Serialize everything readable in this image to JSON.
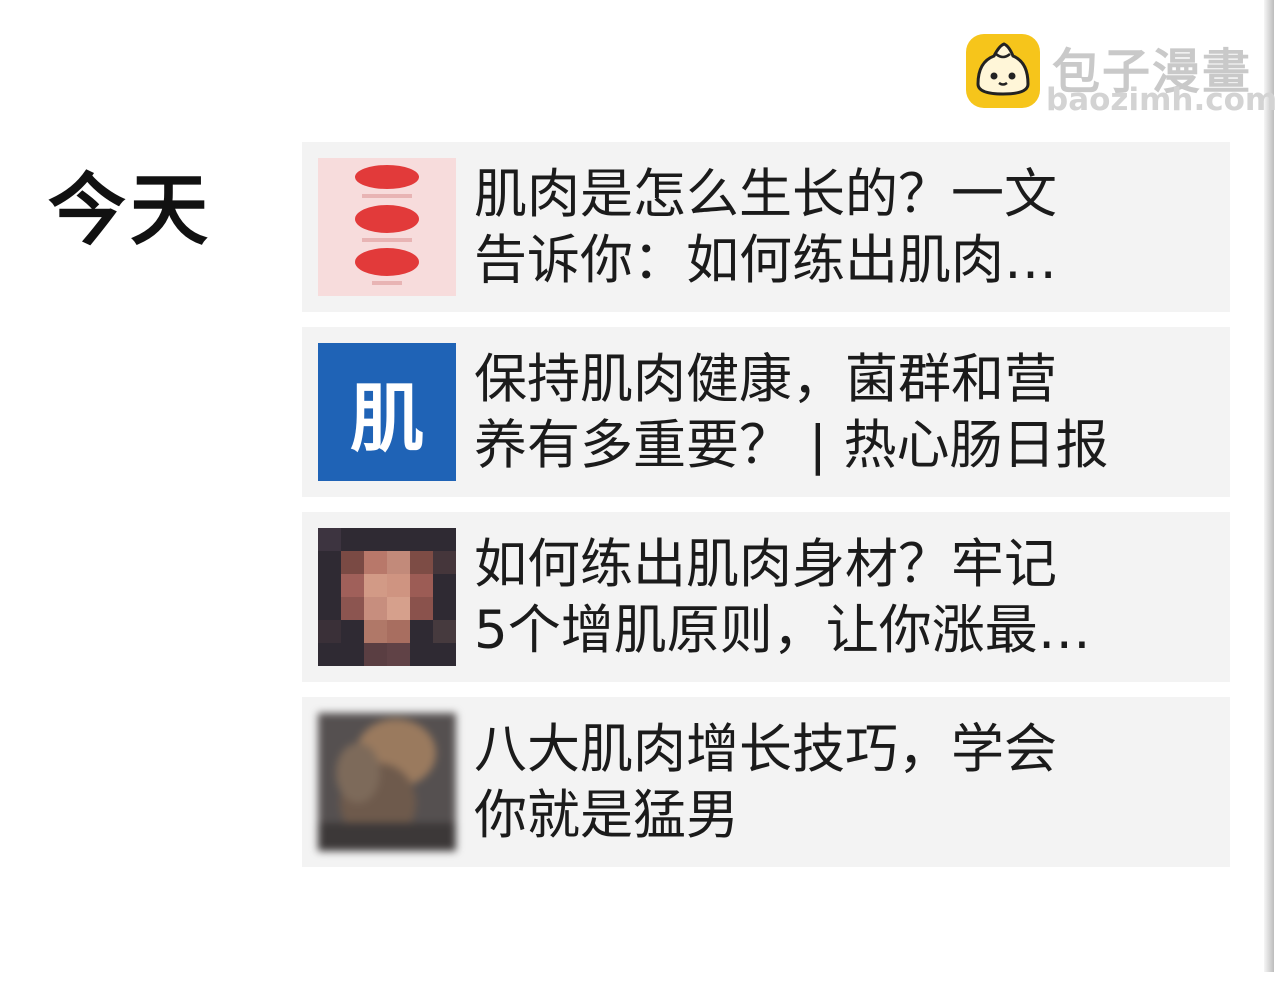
{
  "watermark": {
    "name": "包子漫畫",
    "url": "baozimh.com",
    "logo_icon": "steamed-bun-icon",
    "logo_color": "#f6c51b"
  },
  "section": {
    "title": "今天"
  },
  "results": [
    {
      "title_line1": "肌肉是怎么生长的？一文",
      "title_line2": "告诉你：如何练出肌肉…",
      "thumbnail": "muscle-diagram-thumbnail"
    },
    {
      "title_line1": "保持肌肉健康，菌群和营",
      "title_line2": "养有多重要？ | 热心肠日报",
      "thumbnail_text": "肌",
      "thumbnail_color": "#1f63b6"
    },
    {
      "title_line1": "如何练出肌肉身材？牢记",
      "title_line2": "5个增肌原则，让你涨最…",
      "thumbnail": "bodybuilder-photo-thumbnail"
    },
    {
      "title_line1": "八大肌肉增长技巧，学会",
      "title_line2": "你就是猛男",
      "thumbnail": "athlete-photo-thumbnail"
    }
  ]
}
